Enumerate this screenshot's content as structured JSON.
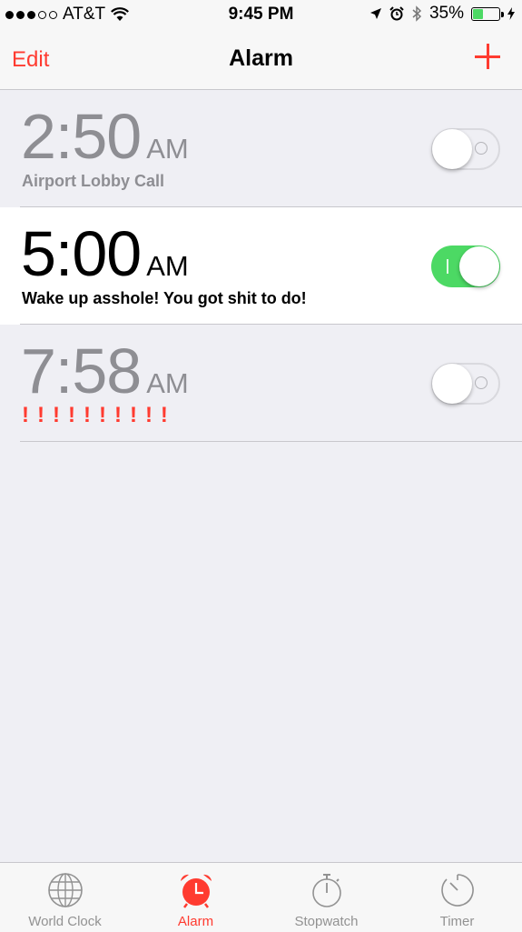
{
  "status_bar": {
    "carrier": "AT&T",
    "time": "9:45 PM",
    "battery": "35%",
    "battery_level": 0.35,
    "signal_bars_filled": 3,
    "signal_bars_total": 5
  },
  "nav": {
    "edit_label": "Edit",
    "title": "Alarm",
    "add_icon": "plus-icon"
  },
  "alarms": [
    {
      "time": "2:50",
      "ampm": "AM",
      "label": "Airport Lobby Call",
      "enabled": false
    },
    {
      "time": "5:00",
      "ampm": "AM",
      "label": "Wake up asshole! You got shit to do!",
      "enabled": true
    },
    {
      "time": "7:58",
      "ampm": "AM",
      "label": "!!!!!!!!!!",
      "enabled": false
    }
  ],
  "tabs": [
    {
      "label": "World Clock",
      "icon": "globe-icon",
      "active": false
    },
    {
      "label": "Alarm",
      "icon": "alarm-clock-icon",
      "active": true
    },
    {
      "label": "Stopwatch",
      "icon": "stopwatch-icon",
      "active": false
    },
    {
      "label": "Timer",
      "icon": "timer-icon",
      "active": false
    }
  ],
  "colors": {
    "accent": "#ff3b30",
    "toggle_on": "#4cd964",
    "inactive_text": "#8e8e93"
  }
}
